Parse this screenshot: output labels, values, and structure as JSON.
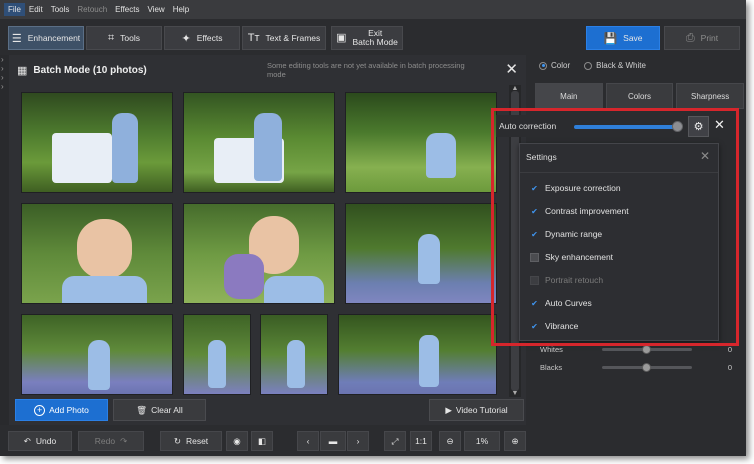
{
  "menu": {
    "items": [
      "File",
      "Edit",
      "Tools",
      "Retouch",
      "Effects",
      "View",
      "Help"
    ]
  },
  "toolbar": {
    "enhancement": "Enhancement",
    "tools": "Tools",
    "effects": "Effects",
    "text_frames": "Text & Frames",
    "exit_line1": "Exit",
    "exit_line2": "Batch Mode",
    "save": "Save",
    "print": "Print"
  },
  "batch": {
    "title": "Batch Mode (10 photos)",
    "note": "Some editing tools are not yet available in batch processing mode"
  },
  "actions": {
    "add_photo": "Add Photo",
    "clear_all": "Clear All",
    "video_tutorial": "Video Tutorial"
  },
  "statusbar": {
    "undo": "Undo",
    "redo": "Redo",
    "reset": "Reset",
    "ratio": "1:1",
    "zoom": "1%"
  },
  "right": {
    "color_mode": {
      "color": "Color",
      "bw": "Black & White",
      "selected": "Color"
    },
    "tabs": [
      "Main",
      "Colors",
      "Sharpness"
    ],
    "selected_tab": "Main",
    "sliders": [
      {
        "label": "Whites",
        "value": "0"
      },
      {
        "label": "Blacks",
        "value": "0"
      }
    ]
  },
  "auto_correction": {
    "label": "Auto correction",
    "level": 1.0
  },
  "settings": {
    "title": "Settings",
    "options": [
      {
        "label": "Exposure correction",
        "checked": true,
        "enabled": true
      },
      {
        "label": "Contrast improvement",
        "checked": true,
        "enabled": true
      },
      {
        "label": "Dynamic range",
        "checked": true,
        "enabled": true
      },
      {
        "label": "Sky enhancement",
        "checked": false,
        "enabled": true
      },
      {
        "label": "Portrait retouch",
        "checked": false,
        "enabled": false
      },
      {
        "label": "Auto Curves",
        "checked": true,
        "enabled": true
      },
      {
        "label": "Vibrance",
        "checked": true,
        "enabled": true
      }
    ]
  },
  "colors": {
    "accent": "#1d6fd1",
    "highlight": "#d6262c",
    "panel": "#2b2c2f"
  }
}
